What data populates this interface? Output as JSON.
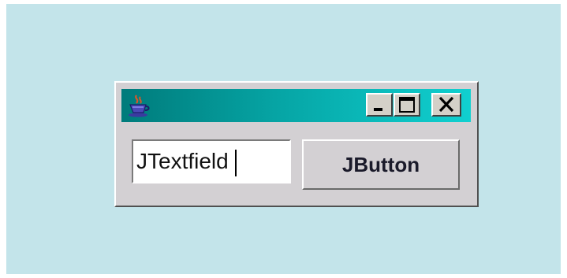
{
  "window": {
    "titlebar": {
      "app_icon": "java-cup-icon",
      "controls": {
        "minimize_icon": "minimize-icon",
        "maximize_icon": "maximize-icon",
        "close_icon": "close-icon"
      },
      "gradient": [
        "#007b7b",
        "#10d0d0"
      ]
    },
    "textfield": {
      "value": "JTextfield"
    },
    "button": {
      "label": "JButton"
    }
  },
  "colors": {
    "desktop": "#c3e4ea",
    "window_body": "#d3d0d3"
  }
}
